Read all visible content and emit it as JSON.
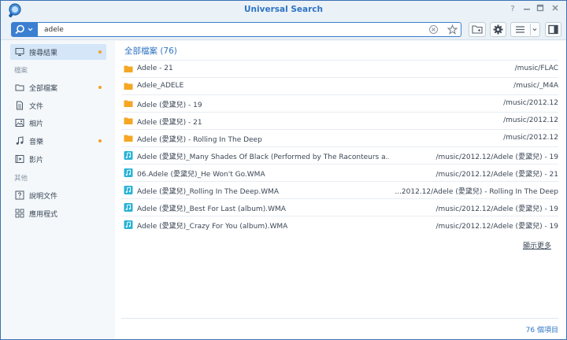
{
  "app": {
    "title": "Universal Search"
  },
  "search": {
    "query": "adele",
    "placeholder": ""
  },
  "sidebar": {
    "results": "搜尋結果",
    "files_section": "檔案",
    "items": [
      {
        "label": "全部檔案",
        "icon": "folder-icon",
        "dot": true
      },
      {
        "label": "文件",
        "icon": "document-icon",
        "dot": false
      },
      {
        "label": "相片",
        "icon": "photo-icon",
        "dot": false
      },
      {
        "label": "音樂",
        "icon": "music-icon",
        "dot": true
      },
      {
        "label": "影片",
        "icon": "video-icon",
        "dot": false
      }
    ],
    "other_section": "其他",
    "other_items": [
      {
        "label": "說明文件",
        "icon": "help-icon"
      },
      {
        "label": "應用程式",
        "icon": "apps-icon"
      }
    ]
  },
  "main": {
    "header": "全部檔案 (76)",
    "rows": [
      {
        "type": "folder",
        "name": "Adele - 21",
        "path": "/music/FLAC"
      },
      {
        "type": "folder",
        "name": "Adele_ADELE",
        "path": "/music/_M4A"
      },
      {
        "type": "folder",
        "name": "Adele (愛黛兒) - 19",
        "path": "/music/2012.12"
      },
      {
        "type": "folder",
        "name": "Adele (愛黛兒) - 21",
        "path": "/music/2012.12"
      },
      {
        "type": "folder",
        "name": "Adele (愛黛兒) - Rolling In The Deep",
        "path": "/music/2012.12"
      },
      {
        "type": "music",
        "name": "Adele (愛黛兒)_Many Shades Of Black (Performed by The Raconteurs a...",
        "path": "/music/2012.12/Adele (愛黛兒) - 19"
      },
      {
        "type": "music",
        "name": "06.Adele (愛黛兒)_He Won't Go.WMA",
        "path": "/music/2012.12/Adele (愛黛兒) - 21"
      },
      {
        "type": "music",
        "name": "Adele (愛黛兒)_Rolling In The Deep.WMA",
        "path": "...2012.12/Adele (愛黛兒) - Rolling In The Deep"
      },
      {
        "type": "music",
        "name": "Adele (愛黛兒)_Best For Last (album).WMA",
        "path": "/music/2012.12/Adele (愛黛兒) - 19"
      },
      {
        "type": "music",
        "name": "Adele (愛黛兒)_Crazy For You (album).WMA",
        "path": "/music/2012.12/Adele (愛黛兒) - 19"
      }
    ],
    "show_more": "顯示更多",
    "count": "76 個項目"
  },
  "colors": {
    "accent": "#2e74c4",
    "folder": "#f5a623",
    "music": "#2bb3d6",
    "dot": "#f3a12c"
  }
}
